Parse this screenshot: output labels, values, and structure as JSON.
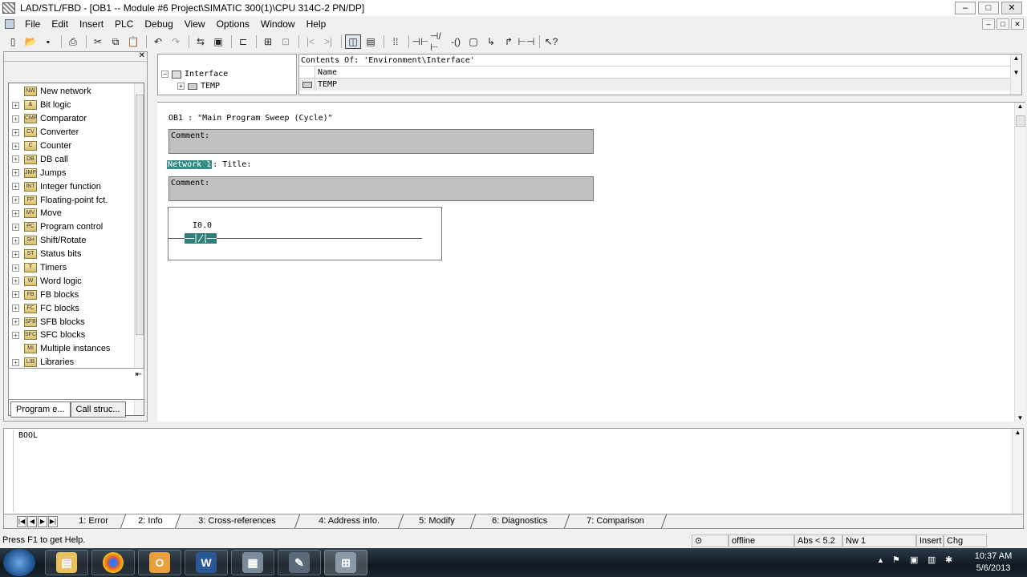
{
  "window": {
    "title": "LAD/STL/FBD  - [OB1 -- Module #6 Project\\SIMATIC 300(1)\\CPU 314C-2 PN/DP]",
    "controls": [
      "–",
      "□",
      "✕"
    ]
  },
  "menu": [
    "File",
    "Edit",
    "Insert",
    "PLC",
    "Debug",
    "View",
    "Options",
    "Window",
    "Help"
  ],
  "toolbar": {
    "icons": [
      "new-icon",
      "open-icon",
      "save-icon",
      "print-icon",
      "cut-icon",
      "copy-icon",
      "paste-icon",
      "undo-icon",
      "redo-icon",
      "load-icon",
      "monitor-icon",
      "compare-icon",
      "stop-icon",
      "mode-icon",
      "prev-icon",
      "next-icon",
      "overview-icon",
      "details-icon",
      "network-icon",
      "contact-no-icon",
      "contact-nc-icon",
      "coil-icon",
      "box-icon",
      "branch-open-icon",
      "branch-close-icon",
      "connection-icon",
      "help-pointer-icon"
    ]
  },
  "catalog": {
    "items": [
      {
        "label": "New network",
        "expandable": false,
        "icon": "NW"
      },
      {
        "label": "Bit logic",
        "expandable": true,
        "icon": "&"
      },
      {
        "label": "Comparator",
        "expandable": true,
        "icon": "CMP"
      },
      {
        "label": "Converter",
        "expandable": true,
        "icon": "CV"
      },
      {
        "label": "Counter",
        "expandable": true,
        "icon": "C"
      },
      {
        "label": "DB call",
        "expandable": true,
        "icon": "DB"
      },
      {
        "label": "Jumps",
        "expandable": true,
        "icon": "JMP"
      },
      {
        "label": "Integer function",
        "expandable": true,
        "icon": "INT"
      },
      {
        "label": "Floating-point fct.",
        "expandable": true,
        "icon": "FP"
      },
      {
        "label": "Move",
        "expandable": true,
        "icon": "MV"
      },
      {
        "label": "Program control",
        "expandable": true,
        "icon": "PC"
      },
      {
        "label": "Shift/Rotate",
        "expandable": true,
        "icon": "SH"
      },
      {
        "label": "Status bits",
        "expandable": true,
        "icon": "ST"
      },
      {
        "label": "Timers",
        "expandable": true,
        "icon": "T"
      },
      {
        "label": "Word logic",
        "expandable": true,
        "icon": "W"
      },
      {
        "label": "FB blocks",
        "expandable": true,
        "icon": "FB"
      },
      {
        "label": "FC blocks",
        "expandable": true,
        "icon": "FC"
      },
      {
        "label": "SFB blocks",
        "expandable": true,
        "icon": "SFB"
      },
      {
        "label": "SFC blocks",
        "expandable": true,
        "icon": "SFC"
      },
      {
        "label": "Multiple instances",
        "expandable": false,
        "icon": "MI"
      },
      {
        "label": "Libraries",
        "expandable": true,
        "icon": "LIB"
      }
    ],
    "tabs": [
      "Program e...",
      "Call struc..."
    ]
  },
  "interface": {
    "tree_root": "Interface",
    "tree_child": "TEMP",
    "contents_of": "Contents Of: 'Environment\\Interface'",
    "column_name": "Name",
    "row_value": "TEMP"
  },
  "editor": {
    "block_header": "OB1 :   \"Main Program Sweep (Cycle)\"",
    "block_comment_label": "Comment:",
    "network_label": "Network 1",
    "network_title": ": Title:",
    "network_comment_label": "Comment:",
    "contact_address": "I0.0"
  },
  "output": {
    "text": "BOOL",
    "tabs": [
      "1: Error",
      "2: Info",
      "3: Cross-references",
      "4: Address info.",
      "5: Modify",
      "6: Diagnostics",
      "7: Comparison"
    ],
    "active_tab": "2: Info"
  },
  "status": {
    "help": "Press F1 to get Help.",
    "online_state": "offline",
    "abs": "Abs < 5.2",
    "network": "Nw 1",
    "insert": "Insert",
    "chg": "Chg"
  },
  "taskbar": {
    "time": "10:37 AM",
    "date": "5/6/2013"
  }
}
